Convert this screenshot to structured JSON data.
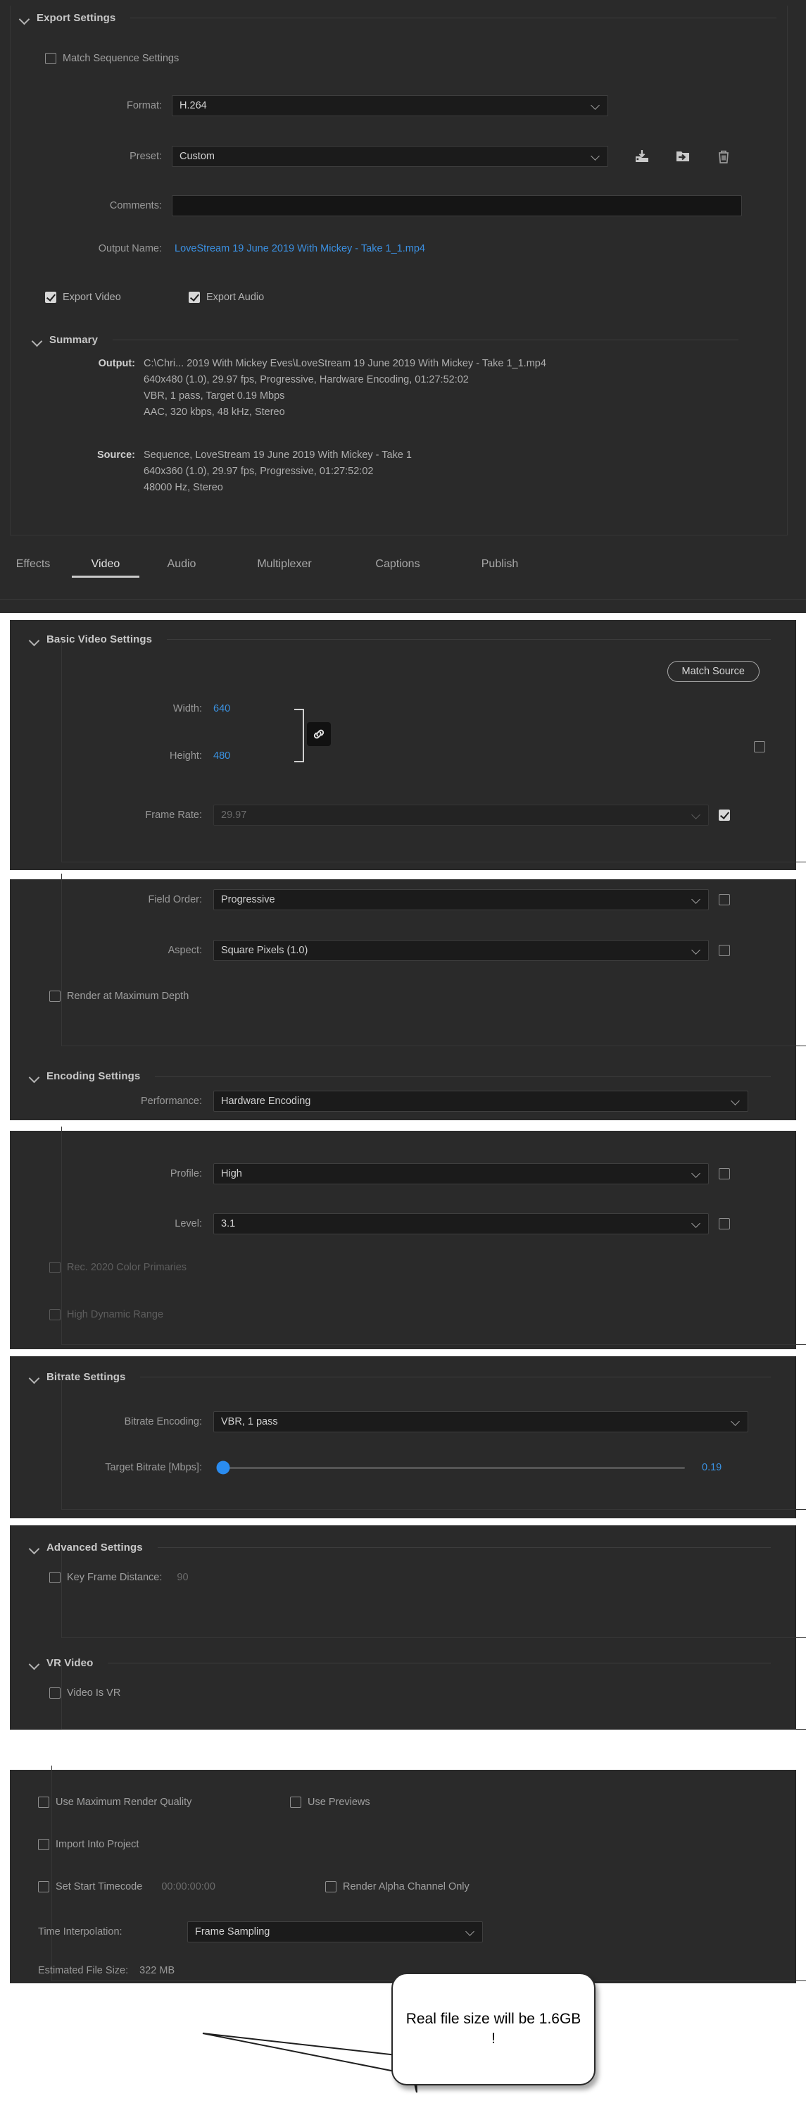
{
  "export_settings": {
    "title": "Export Settings",
    "match_sequence": {
      "label": "Match Sequence Settings",
      "checked": false
    },
    "format": {
      "label": "Format:",
      "value": "H.264"
    },
    "preset": {
      "label": "Preset:",
      "value": "Custom"
    },
    "preset_icons": [
      "save-preset-icon",
      "import-preset-icon",
      "delete-preset-icon"
    ],
    "comments": {
      "label": "Comments:",
      "value": "",
      "placeholder": ""
    },
    "output_name": {
      "label": "Output Name:",
      "value": "LoveStream 19 June 2019 With Mickey - Take 1_1.mp4"
    },
    "export_video": {
      "label": "Export Video",
      "checked": true
    },
    "export_audio": {
      "label": "Export Audio",
      "checked": true
    },
    "summary": {
      "title": "Summary",
      "output_key": "Output:",
      "output_lines": [
        "C:\\Chri... 2019 With Mickey Eves\\LoveStream 19 June 2019 With Mickey - Take 1_1.mp4",
        "640x480 (1.0), 29.97 fps, Progressive, Hardware Encoding, 01:27:52:02",
        "VBR, 1 pass, Target 0.19 Mbps",
        "AAC, 320 kbps, 48 kHz, Stereo"
      ],
      "source_key": "Source:",
      "source_lines": [
        "Sequence, LoveStream 19 June 2019 With Mickey - Take 1",
        "640x360 (1.0), 29.97 fps, Progressive, 01:27:52:02",
        "48000 Hz, Stereo"
      ]
    }
  },
  "tabs": {
    "items": [
      "Effects",
      "Video",
      "Audio",
      "Multiplexer",
      "Captions",
      "Publish"
    ],
    "active": "Video"
  },
  "basic_video": {
    "title": "Basic Video Settings",
    "match_source_button": "Match Source",
    "width": {
      "label": "Width:",
      "value": "640",
      "checkbox": false
    },
    "height": {
      "label": "Height:",
      "value": "480"
    },
    "link_icon": "chain-link-icon",
    "frame_rate": {
      "label": "Frame Rate:",
      "value": "29.97",
      "disabled": true,
      "checkbox": true
    }
  },
  "field_aspect": {
    "field_order": {
      "label": "Field Order:",
      "value": "Progressive",
      "checkbox": false
    },
    "aspect": {
      "label": "Aspect:",
      "value": "Square Pixels (1.0)",
      "checkbox": false
    },
    "render_max_depth": {
      "label": "Render at Maximum Depth",
      "checked": false
    }
  },
  "encoding": {
    "title": "Encoding Settings",
    "performance": {
      "label": "Performance:",
      "value": "Hardware Encoding"
    }
  },
  "profile_level": {
    "profile": {
      "label": "Profile:",
      "value": "High",
      "checkbox": false
    },
    "level": {
      "label": "Level:",
      "value": "3.1",
      "checkbox": false
    },
    "rec2020": {
      "label": "Rec. 2020 Color Primaries",
      "checked": false,
      "disabled": true
    },
    "hdr": {
      "label": "High Dynamic Range",
      "checked": false,
      "disabled": true
    }
  },
  "bitrate": {
    "title": "Bitrate Settings",
    "encoding": {
      "label": "Bitrate Encoding:",
      "value": "VBR, 1 pass"
    },
    "target": {
      "label": "Target Bitrate [Mbps]:",
      "value": "0.19",
      "percent": 0
    }
  },
  "advanced": {
    "title": "Advanced Settings",
    "key_frame_distance": {
      "label": "Key Frame Distance:",
      "value": "90",
      "checked": false
    }
  },
  "vr": {
    "title": "VR Video",
    "video_is_vr": {
      "label": "Video Is VR",
      "checked": false
    }
  },
  "footer": {
    "use_max_render_quality": {
      "label": "Use Maximum Render Quality",
      "checked": false
    },
    "use_previews": {
      "label": "Use Previews",
      "checked": false
    },
    "import_into_project": {
      "label": "Import Into Project",
      "checked": false
    },
    "set_start_timecode": {
      "label": "Set Start Timecode",
      "checked": false,
      "value": "00:00:00:00"
    },
    "render_alpha_only": {
      "label": "Render Alpha Channel Only",
      "checked": false
    },
    "time_interpolation": {
      "label": "Time Interpolation:",
      "value": "Frame Sampling"
    },
    "estimated_file_size": {
      "label": "Estimated File Size:",
      "value": "322 MB"
    }
  },
  "callout": {
    "text": "Real file size will be 1.6GB !"
  },
  "colors": {
    "accent_blue": "#3b90e2",
    "slider_blue": "#2a8cf0",
    "panel_bg": "#2a2a2a",
    "input_bg": "#1b1b1b"
  }
}
